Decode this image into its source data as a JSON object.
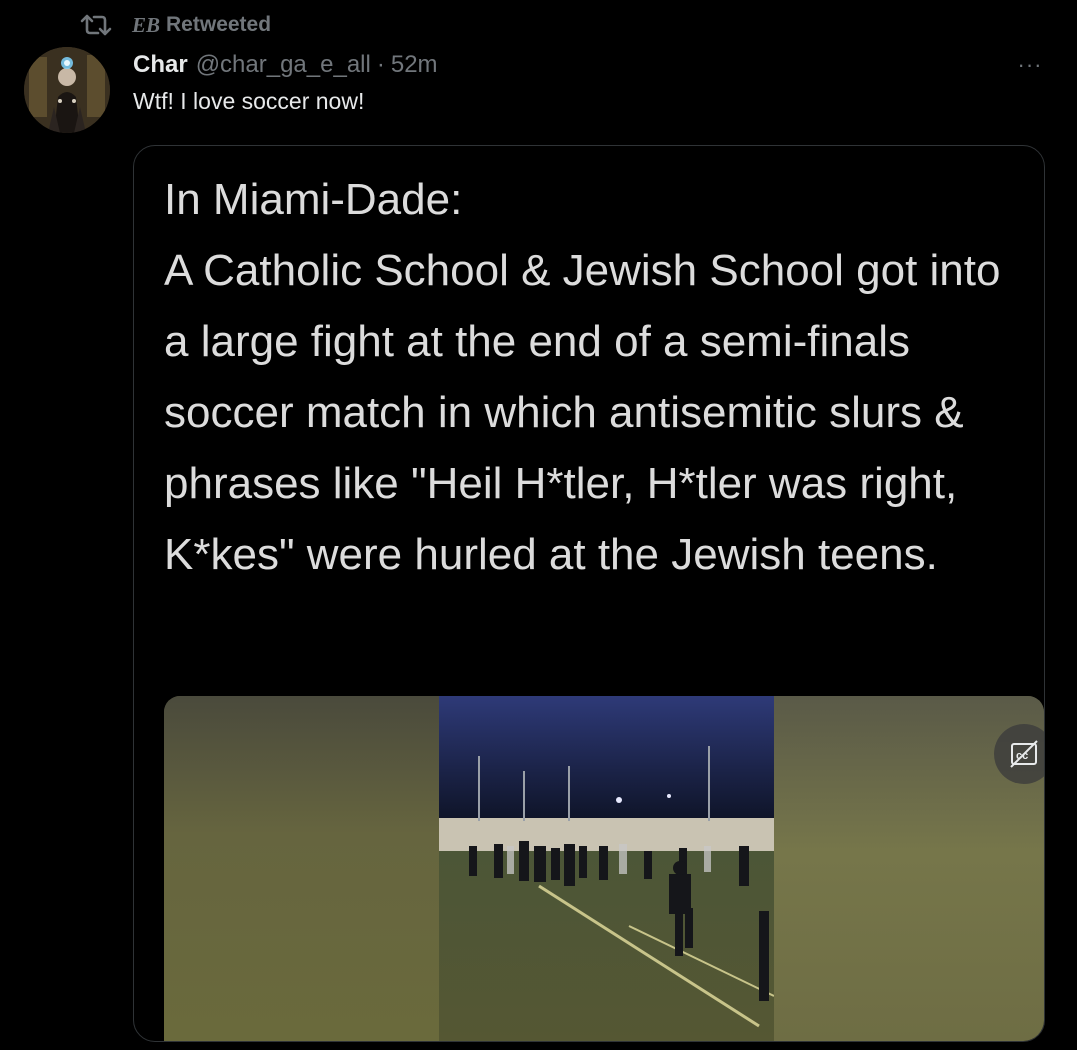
{
  "retweet": {
    "icon": "retweet-icon",
    "name": "EB",
    "label": "Retweeted"
  },
  "author": {
    "display_name": "Char",
    "handle": "@char_ga_e_all",
    "separator": "·",
    "time": "52m",
    "avatar_icon": "avatar-image"
  },
  "more_icon": "more-icon",
  "more_label": "···",
  "tweet": {
    "text": "Wtf! I love soccer now!"
  },
  "media": {
    "caption": "In Miami-Dade:\nA Catholic School & Jewish School got into a large fight at the end of a semi-finals soccer match in which antisemitic slurs & phrases like \"Heil H*tler, H*tler was right, K*kes\" were hurled at the Jewish teens.",
    "video_icon": "video-thumbnail",
    "cc_icon": "closed-captions-off-icon"
  },
  "colors": {
    "background": "#000000",
    "text": "#e7e9ea",
    "secondary": "#71767b",
    "border": "#2f3336"
  }
}
